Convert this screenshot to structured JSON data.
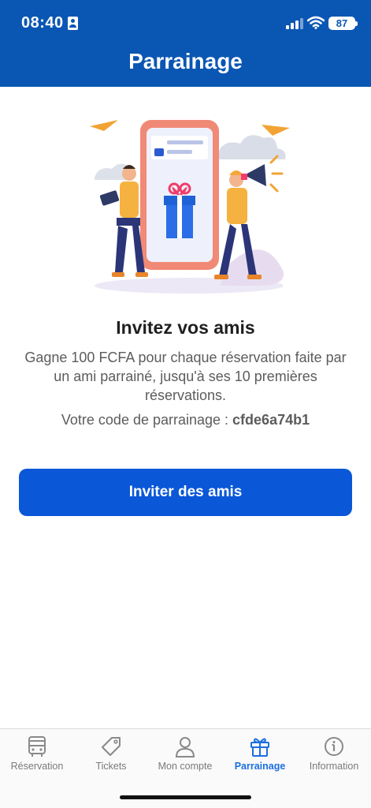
{
  "status_bar": {
    "time": "08:40",
    "battery": "87"
  },
  "header": {
    "title": "Parrainage"
  },
  "referral": {
    "title": "Invitez vos amis",
    "description": "Gagne 100 FCFA pour chaque réservation faite par un ami parrainé, jusqu'à ses 10 premières réservations.",
    "code_label": "Votre code de parrainage : ",
    "code_value": "cfde6a74b1",
    "button_label": "Inviter des amis"
  },
  "tab_bar": {
    "tabs": [
      {
        "label": "Réservation",
        "icon": "bus-icon",
        "active": false
      },
      {
        "label": "Tickets",
        "icon": "tag-icon",
        "active": false
      },
      {
        "label": "Mon compte",
        "icon": "user-icon",
        "active": false
      },
      {
        "label": "Parrainage",
        "icon": "gift-icon",
        "active": true
      },
      {
        "label": "Information",
        "icon": "info-icon",
        "active": false
      }
    ]
  },
  "colors": {
    "header_bg": "#0a56b3",
    "button_bg": "#0a58d8",
    "active_tab": "#1b6fe0",
    "inactive_tab": "#7a7a7a"
  }
}
